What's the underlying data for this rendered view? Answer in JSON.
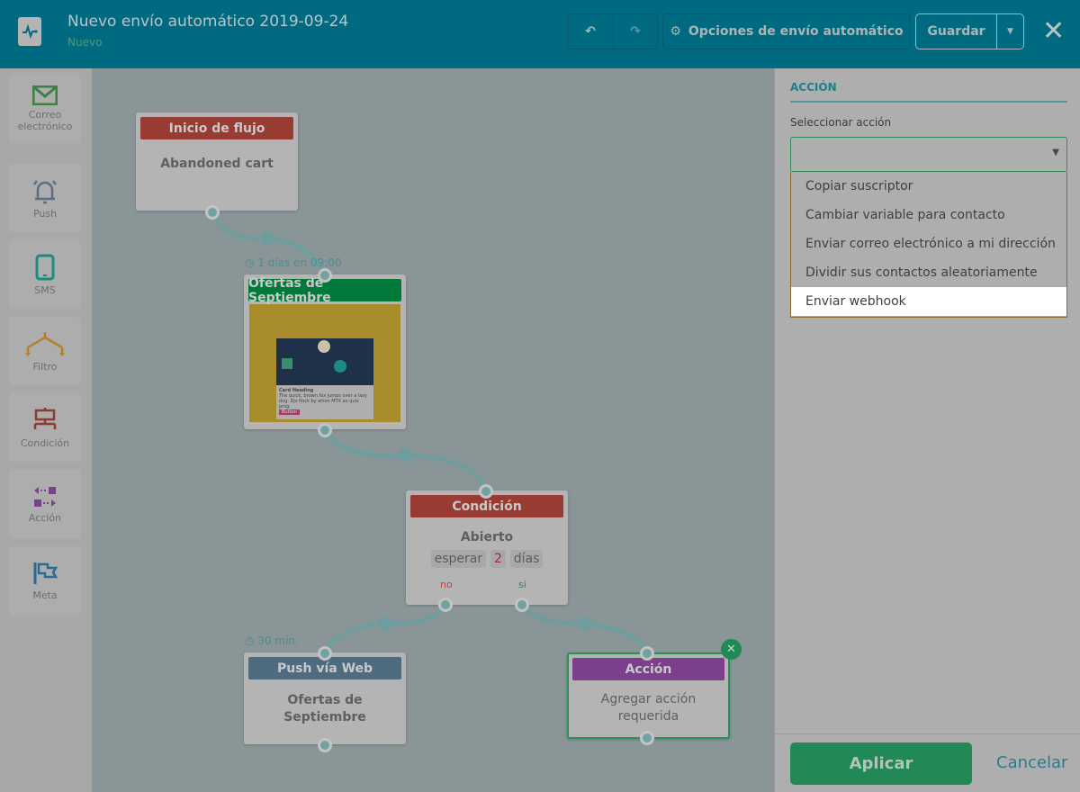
{
  "header": {
    "title": "Nuevo envío automático 2019-09-24",
    "status": "Nuevo",
    "options_label": "Opciones de envío automático",
    "save_label": "Guardar"
  },
  "sidebar": {
    "items": [
      {
        "label": "Correo electrónico",
        "icon": "envelope-icon",
        "color": "#3f7f44"
      },
      {
        "label": "Push",
        "icon": "bell-icon",
        "color": "#5a6f82"
      },
      {
        "label": "SMS",
        "icon": "tablet-icon",
        "color": "#1e8a7f"
      },
      {
        "label": "Filtro",
        "icon": "filter-icon",
        "color": "#b5802a"
      },
      {
        "label": "Condición",
        "icon": "condition-icon",
        "color": "#8e3a34"
      },
      {
        "label": "Acción",
        "icon": "action-icon",
        "color": "#7a4288"
      },
      {
        "label": "Meta",
        "icon": "flag-icon",
        "color": "#2a6a94"
      }
    ]
  },
  "flow": {
    "start": {
      "header": "Inicio de flujo",
      "body": "Abandoned cart"
    },
    "timer1": "1 días en 09:00",
    "email": {
      "header": "Ofertas de Septiembre",
      "preview_heading": "Card Heading",
      "preview_text": "The quick, brown fox jumps over a lazy dog. Djs flock by when MTV ax quiz prog.",
      "preview_button": "Button"
    },
    "condition": {
      "header": "Condición",
      "body": "Abierto",
      "wait": "esperar",
      "amount": "2",
      "unit": "días",
      "no": "no",
      "yes": "si"
    },
    "timer2": "30 min.",
    "push": {
      "header": "Push vía Web",
      "body": "Ofertas de Septiembre"
    },
    "action": {
      "header": "Acción",
      "body": "Agregar acción requerida"
    }
  },
  "panel": {
    "title": "ACCIÓN",
    "select_label": "Seleccionar acción",
    "select_value": "",
    "options": [
      "Copiar suscriptor",
      "Cambiar variable para contacto",
      "Enviar correo electrónico a mi dirección",
      "Dividir sus contactos aleatoriamente",
      "Enviar webhook"
    ],
    "highlighted": 4,
    "apply": "Aplicar",
    "cancel": "Cancelar"
  }
}
